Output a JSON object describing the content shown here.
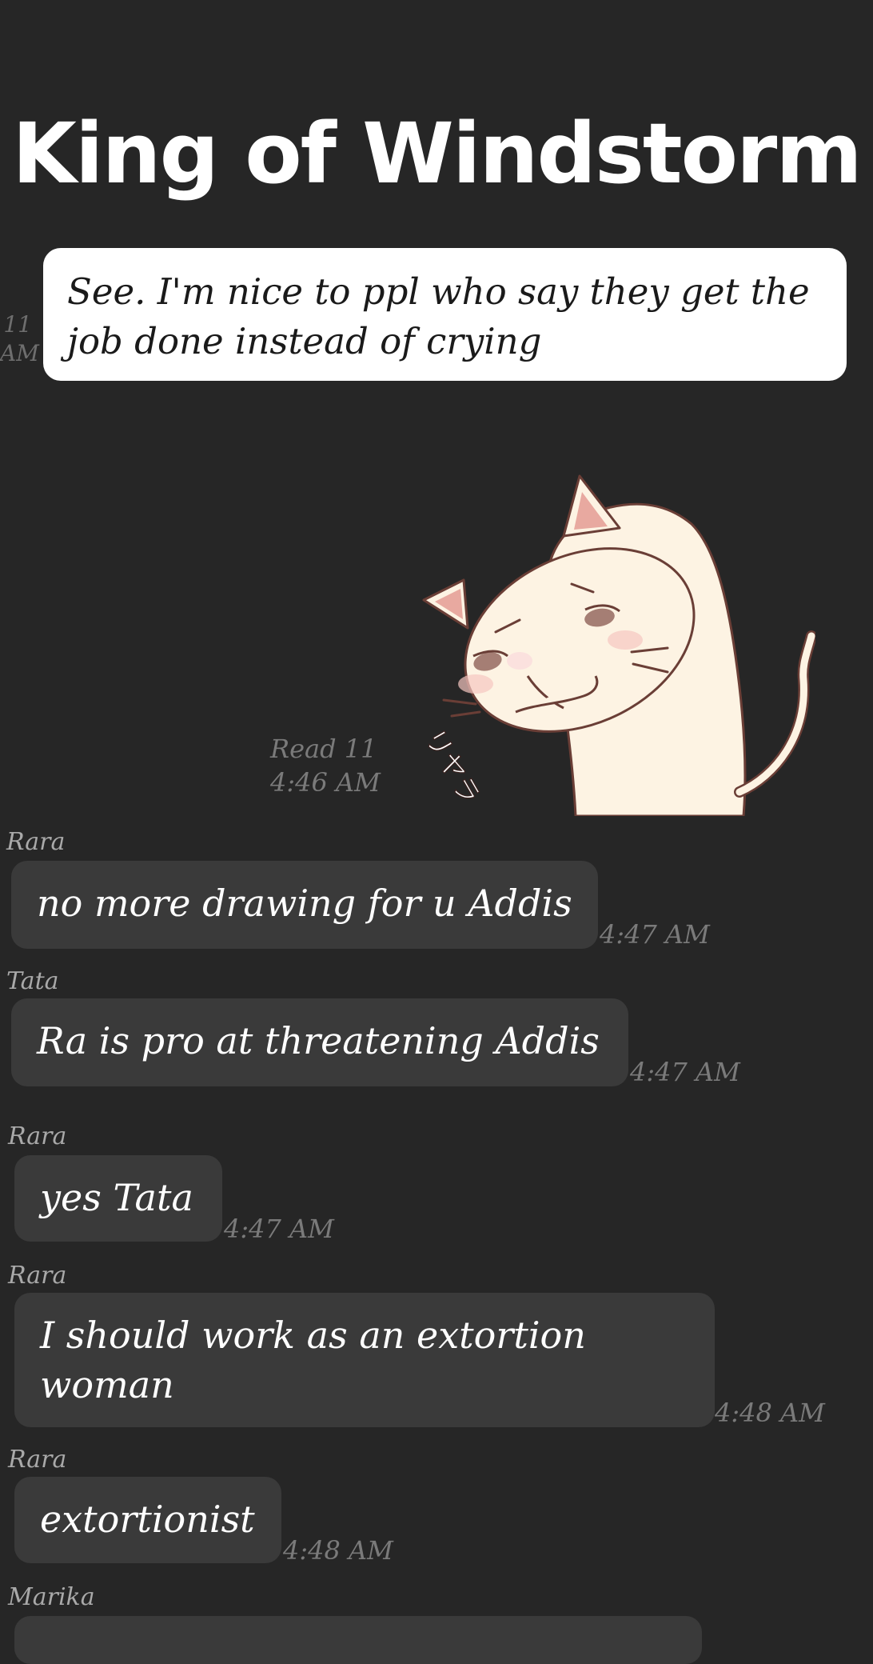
{
  "header": {
    "title": "King of Windstorm"
  },
  "chat": {
    "edge_read": [
      "11",
      "AM"
    ],
    "outgoing": {
      "text": "See. I'm nice to ppl who say they get the job done instead of crying"
    },
    "sticker": {
      "icon": "cat-sticker",
      "caption": "リヤラ",
      "read_label": "Read 11",
      "read_time": "4:46 AM"
    },
    "messages": [
      {
        "sender": "Rara",
        "text": "no more drawing for u Addis",
        "time": "4:47 AM"
      },
      {
        "sender": "Tata",
        "text": "Ra is pro at threatening Addis",
        "time": "4:47 AM"
      },
      {
        "sender": "Rara",
        "text": "yes Tata",
        "time": "4:47 AM"
      },
      {
        "sender": "Rara",
        "text": "I should work as an extortion woman",
        "time": "4:48 AM"
      },
      {
        "sender": "Rara",
        "text": "extortionist",
        "time": "4:48 AM"
      },
      {
        "sender": "Marika",
        "text": "",
        "time": ""
      }
    ]
  },
  "colors": {
    "background": "#262626",
    "incoming_bubble": "#3a3a3a",
    "outgoing_bubble": "#ffffff",
    "timestamp": "#7a7a7a"
  }
}
